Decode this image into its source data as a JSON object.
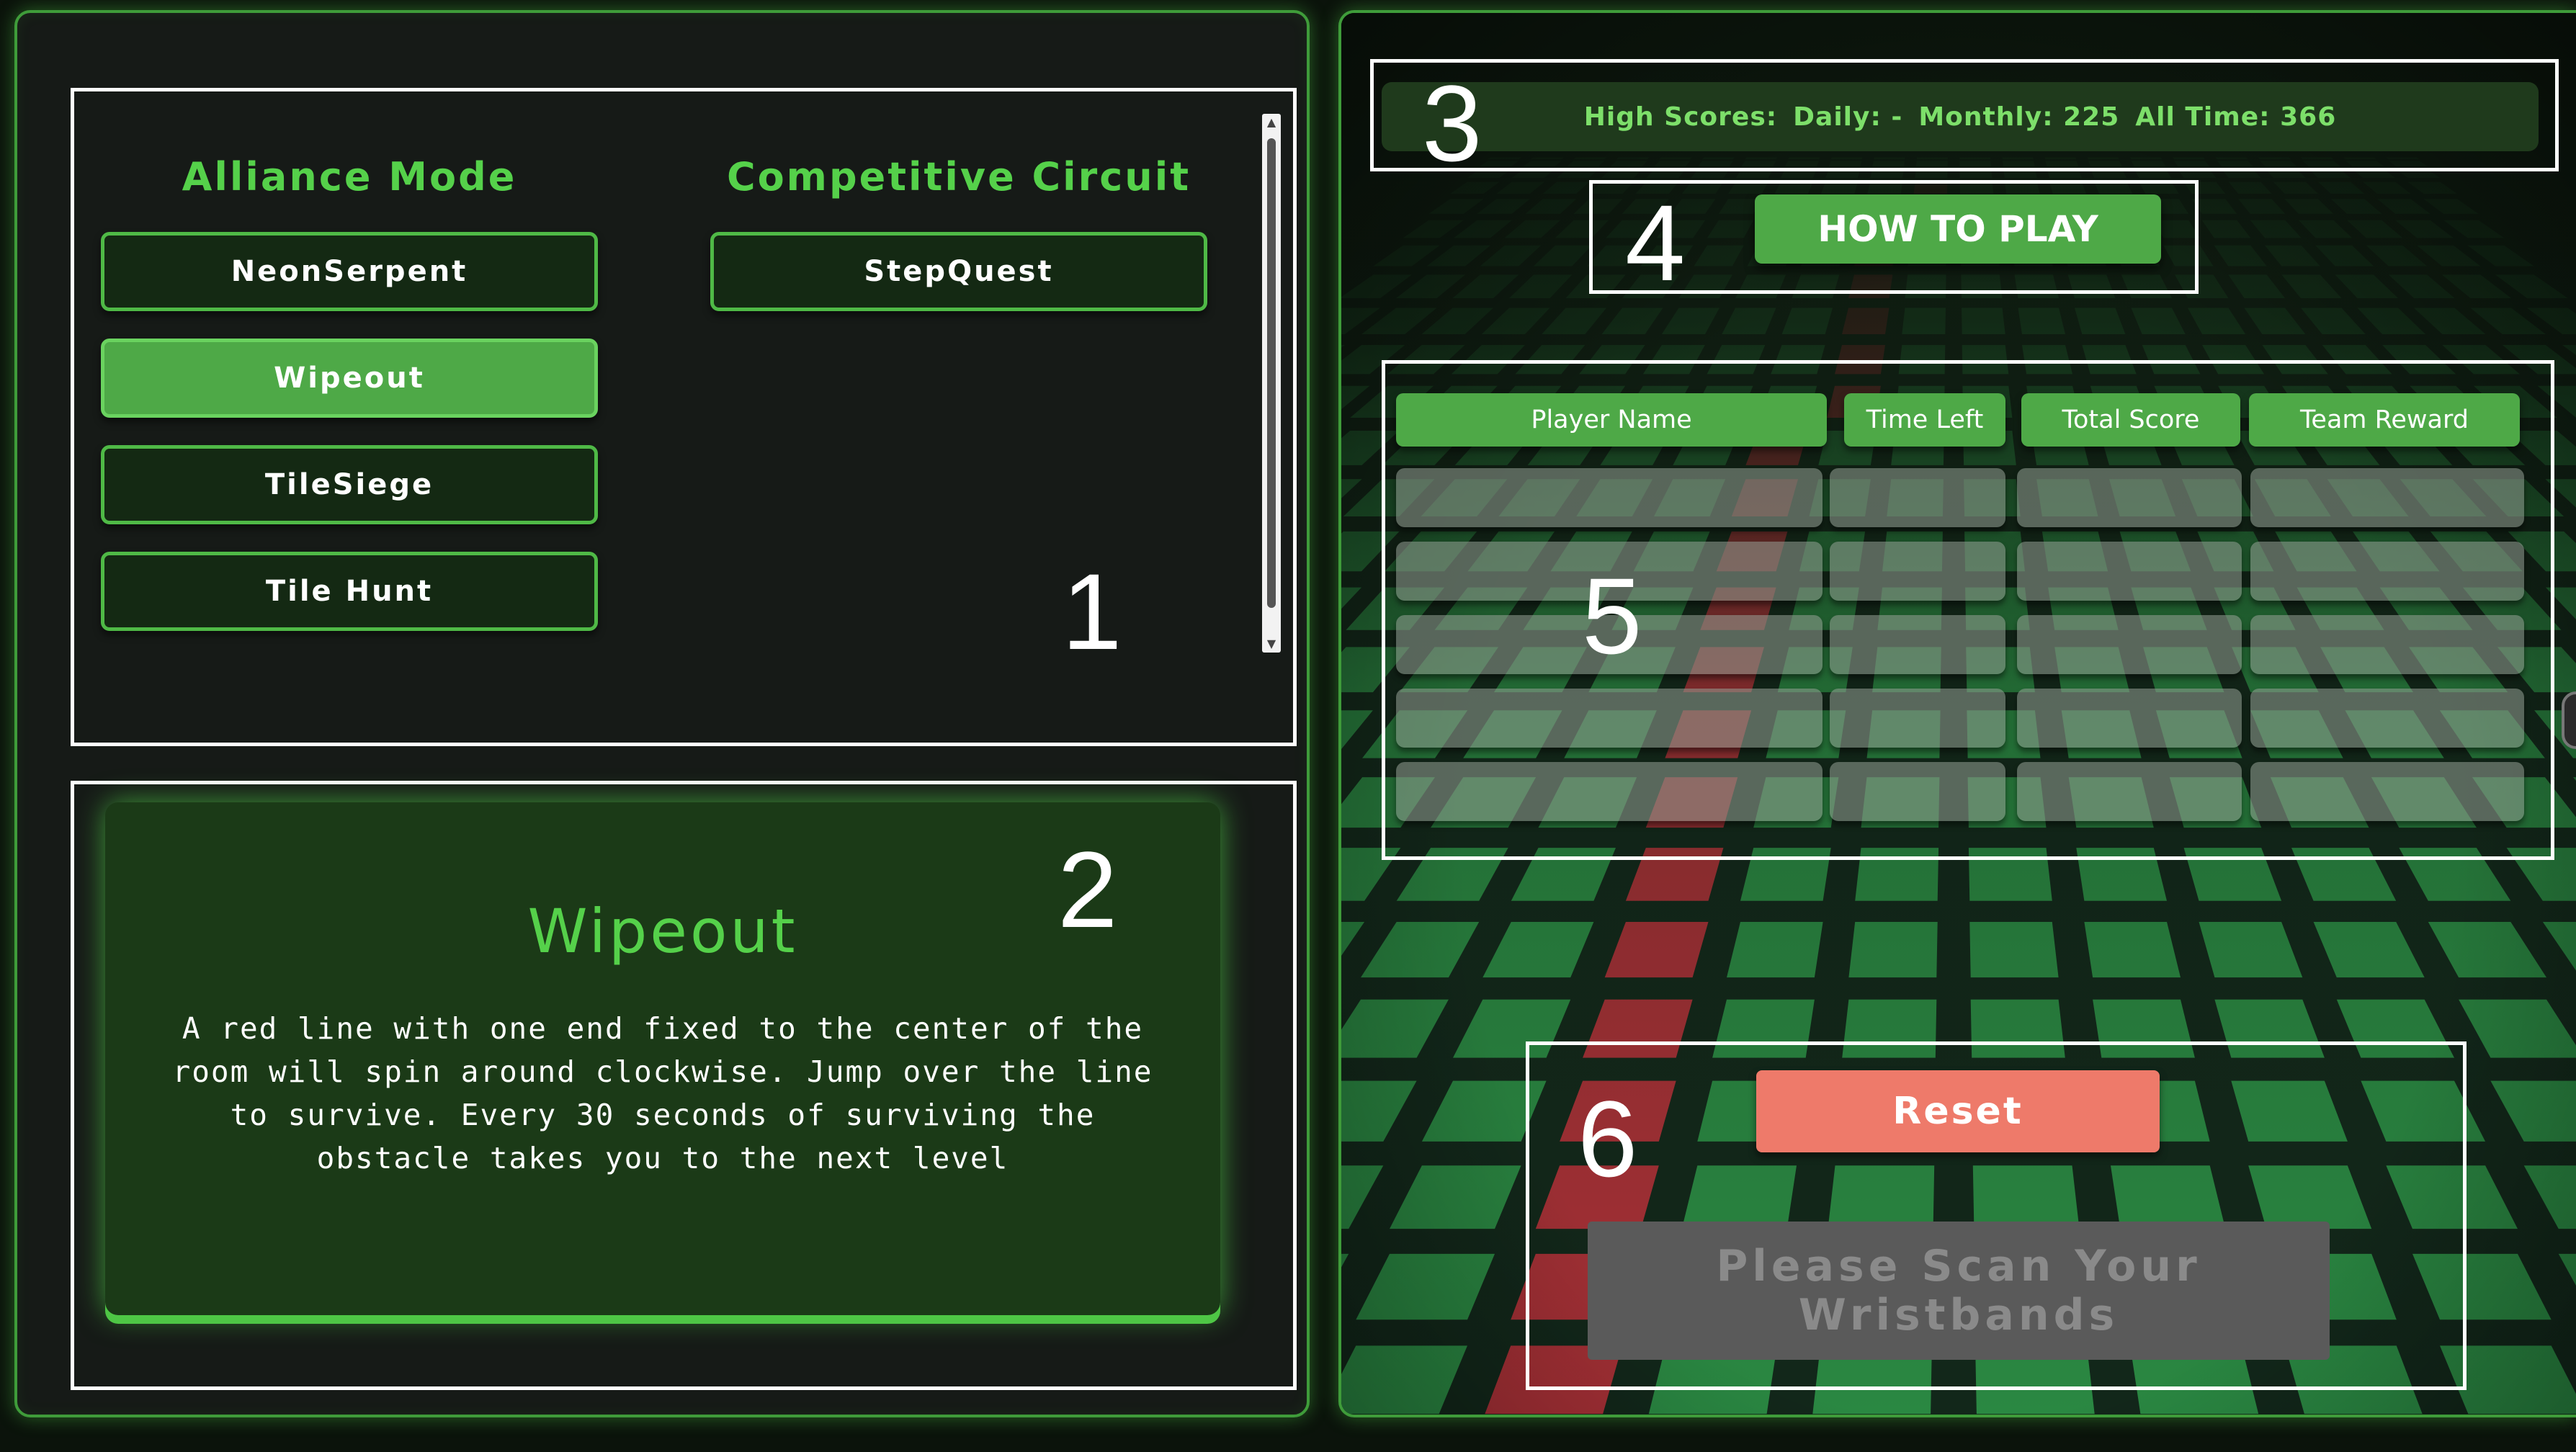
{
  "game_select": {
    "alliance_heading": "Alliance Mode",
    "competitive_heading": "Competitive Circuit",
    "alliance_games": [
      "NeonSerpent",
      "Wipeout",
      "TileSiege",
      "Tile Hunt"
    ],
    "competitive_games": [
      "StepQuest"
    ],
    "selected_game": "Wipeout"
  },
  "description": {
    "title": "Wipeout",
    "text": "A red line with one end fixed to the center of the room will spin around clockwise. Jump over the line to survive. Every 30 seconds of surviving the obstacle takes you to the next level"
  },
  "high_scores": {
    "label": "High Scores:",
    "daily": "Daily: -",
    "monthly": "Monthly: 225",
    "all_time": "All Time: 366"
  },
  "how_to_play": {
    "label": "HOW TO PLAY"
  },
  "score_table": {
    "headers": [
      "Player Name",
      "Time Left",
      "Total Score",
      "Team Reward"
    ],
    "row_count": 5
  },
  "controls": {
    "reset_label": "Reset",
    "scan_label": "Please Scan Your Wristbands"
  },
  "annotations": [
    "1",
    "2",
    "3",
    "4",
    "5",
    "6"
  ],
  "colors": {
    "accent_green": "#4ea947",
    "heading_green": "#55d14a",
    "reset_salmon": "#ee7a6a",
    "disabled_gray": "#5a5a5a",
    "panel_dark": "#161a17"
  }
}
